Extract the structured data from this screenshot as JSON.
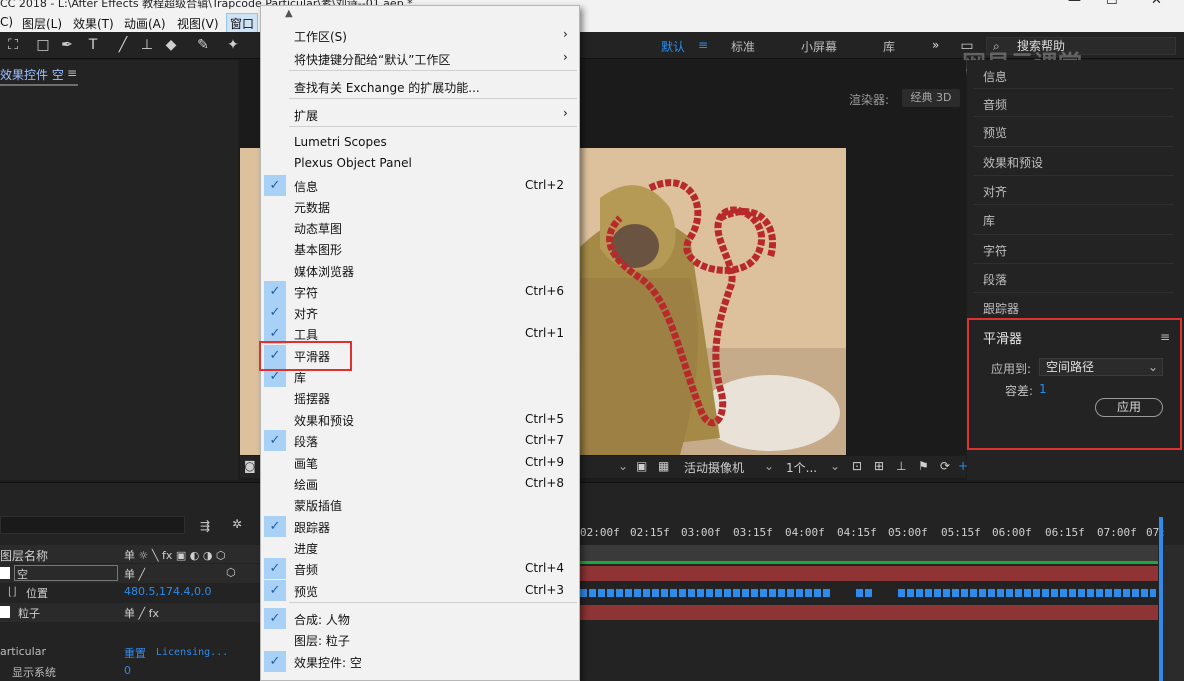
{
  "window": {
    "title": "CC 2018 - L:\\After Effects 教程超级合辑\\Trapcode Particular\\素\\刘诗--01.aep *",
    "minimize": "—",
    "maximize": "☐",
    "close": "✕"
  },
  "menubar": {
    "items": [
      "C)",
      "图层(L)",
      "效果(T)",
      "动画(A)",
      "视图(V)",
      "窗口"
    ]
  },
  "toolbar": {
    "workspaces": [
      "默认",
      "标准",
      "小屏幕",
      "库"
    ],
    "workspace_menu": "≡",
    "more": "»",
    "search_placeholder": "搜索帮助"
  },
  "watermark": "网易云课堂",
  "left_panel": {
    "tab_label": "效果控件 空",
    "tab_menu": "≡"
  },
  "viewer": {
    "renderer_label": "渲染器:",
    "renderer_value": "经典 3D",
    "bottom": {
      "camera": "活动摄像机",
      "views": "1个...",
      "plus": "+"
    }
  },
  "right_panel": {
    "items": [
      "信息",
      "音频",
      "预览",
      "效果和预设",
      "对齐",
      "库",
      "字符",
      "段落",
      "跟踪器"
    ]
  },
  "smoother": {
    "title": "平滑器",
    "menu": "≡",
    "apply_to_label": "应用到:",
    "apply_to_value": "空间路径",
    "tolerance_label": "容差:",
    "tolerance_value": "1",
    "apply_button": "应用"
  },
  "timeline": {
    "ticks": [
      "02:00f",
      "02:15f",
      "03:00f",
      "03:15f",
      "04:00f",
      "04:15f",
      "05:00f",
      "05:15f",
      "06:00f",
      "06:15f",
      "07:00f",
      "07:"
    ],
    "header": {
      "layer_name": "图层名称",
      "switches": "单 ☼ ╲ fx ▣ ◐ ◑ ⬡"
    },
    "rows": [
      {
        "name": "空",
        "switch": "单   ╱"
      },
      {
        "name": "位置",
        "value": "480.5,174.4,0.0"
      },
      {
        "name": "粒子",
        "switch": "单 ╱ fx"
      }
    ],
    "effect": {
      "name": "articular",
      "reset": "重置",
      "licensing": "Licensing...",
      "sub": "显示系统",
      "sub_value": "0"
    }
  },
  "dropdown": {
    "items": [
      {
        "label": "工作区(S)",
        "arrow": "›"
      },
      {
        "label": "将快捷键分配给“默认”工作区",
        "arrow": "›"
      },
      {
        "label": "查找有关 Exchange 的扩展功能..."
      },
      {
        "label": "扩展",
        "arrow": "›"
      },
      {
        "label": "Lumetri Scopes"
      },
      {
        "label": "Plexus Object Panel"
      },
      {
        "label": "信息",
        "checked": true,
        "shortcut": "Ctrl+2"
      },
      {
        "label": "元数据"
      },
      {
        "label": "动态草图"
      },
      {
        "label": "基本图形"
      },
      {
        "label": "媒体浏览器"
      },
      {
        "label": "字符",
        "checked": true,
        "shortcut": "Ctrl+6"
      },
      {
        "label": "对齐",
        "checked": true
      },
      {
        "label": "工具",
        "checked": true,
        "shortcut": "Ctrl+1"
      },
      {
        "label": "平滑器",
        "checked": true
      },
      {
        "label": "库",
        "checked": true
      },
      {
        "label": "摇摆器"
      },
      {
        "label": "效果和预设",
        "shortcut": "Ctrl+5"
      },
      {
        "label": "段落",
        "checked": true,
        "shortcut": "Ctrl+7"
      },
      {
        "label": "画笔",
        "shortcut": "Ctrl+9"
      },
      {
        "label": "绘画",
        "shortcut": "Ctrl+8"
      },
      {
        "label": "蒙版插值"
      },
      {
        "label": "跟踪器",
        "checked": true
      },
      {
        "label": "进度"
      },
      {
        "label": "音频",
        "checked": true,
        "shortcut": "Ctrl+4"
      },
      {
        "label": "预览",
        "checked": true,
        "shortcut": "Ctrl+3"
      },
      {
        "label": "合成: 人物",
        "checked": true
      },
      {
        "label": "图层: 粒子"
      },
      {
        "label": "效果控件: 空",
        "checked": true
      }
    ],
    "checkmark": "✓",
    "up_arrow": "▲"
  },
  "colors": {
    "accent": "#2d8ceb",
    "highlight_box": "#e03131",
    "check_bg": "#a9d0f5",
    "particle_red": "#b8292c",
    "layer_bar": "#8e3434"
  }
}
